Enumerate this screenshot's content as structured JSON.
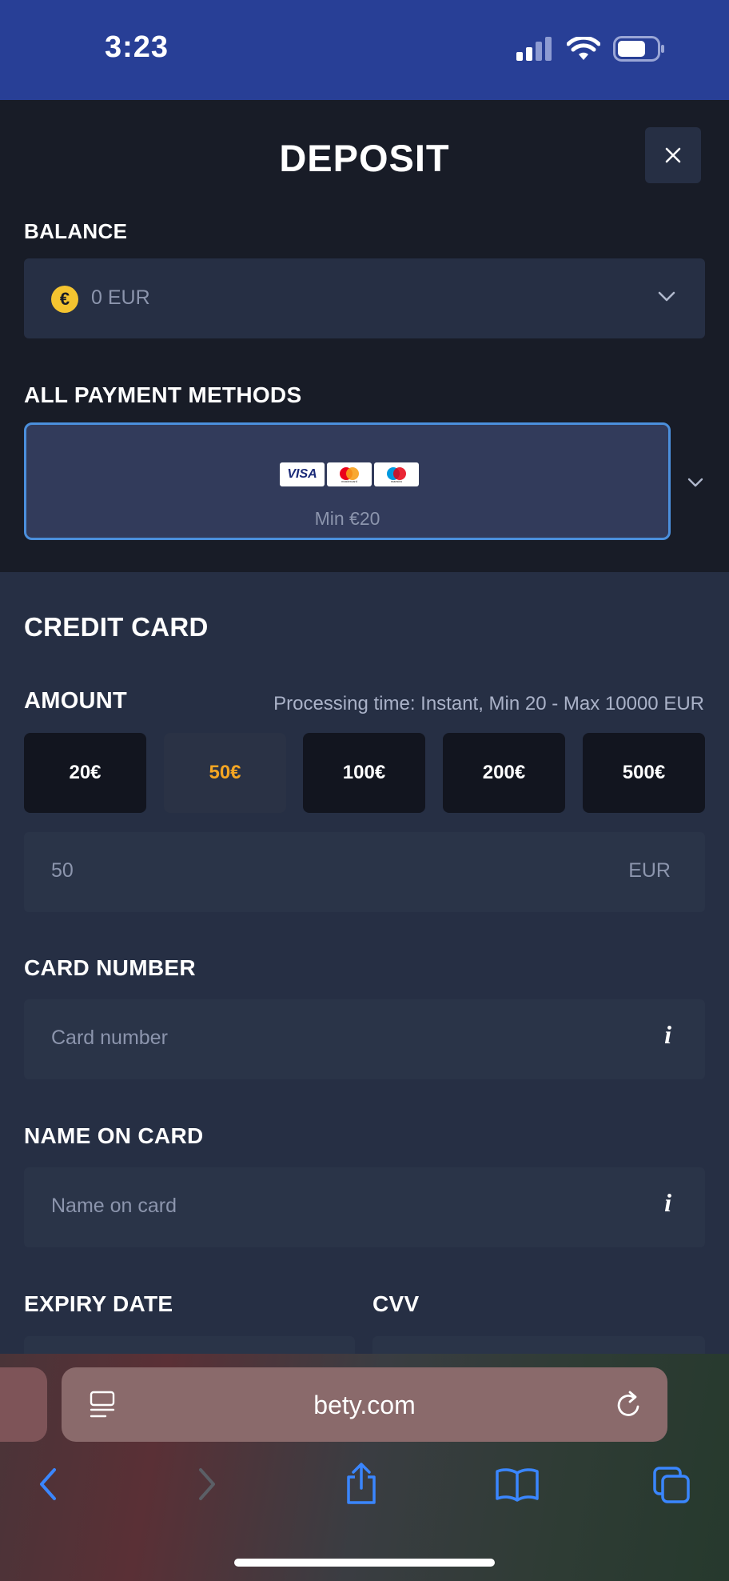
{
  "status_bar": {
    "time": "3:23"
  },
  "header": {
    "title": "DEPOSIT",
    "close_icon": "close-icon"
  },
  "balance": {
    "label": "BALANCE",
    "currency_symbol": "€",
    "value": "0 EUR"
  },
  "payment_methods": {
    "label": "ALL PAYMENT METHODS",
    "selected": {
      "logos": [
        "VISA",
        "mastercard",
        "maestro"
      ],
      "min": "Min €20"
    }
  },
  "credit_card": {
    "title": "CREDIT CARD",
    "amount_label": "AMOUNT",
    "processing": "Processing time: Instant, Min 20 - Max 10000 EUR",
    "presets": [
      "20€",
      "50€",
      "100€",
      "200€",
      "500€"
    ],
    "selected_preset": "50€",
    "amount_value": "50",
    "amount_currency": "EUR",
    "card_number_label": "CARD NUMBER",
    "card_number_placeholder": "Card number",
    "name_label": "NAME ON CARD",
    "name_placeholder": "Name on card",
    "info_glyph": "i",
    "expiry_label": "EXPIRY DATE",
    "cvv_label": "CVV"
  },
  "browser": {
    "url": "bety.com"
  },
  "colors": {
    "accent": "#f5a623",
    "header_blue": "#283f96",
    "selection_border": "#4b8fdc",
    "link_blue": "#3a86ff"
  }
}
